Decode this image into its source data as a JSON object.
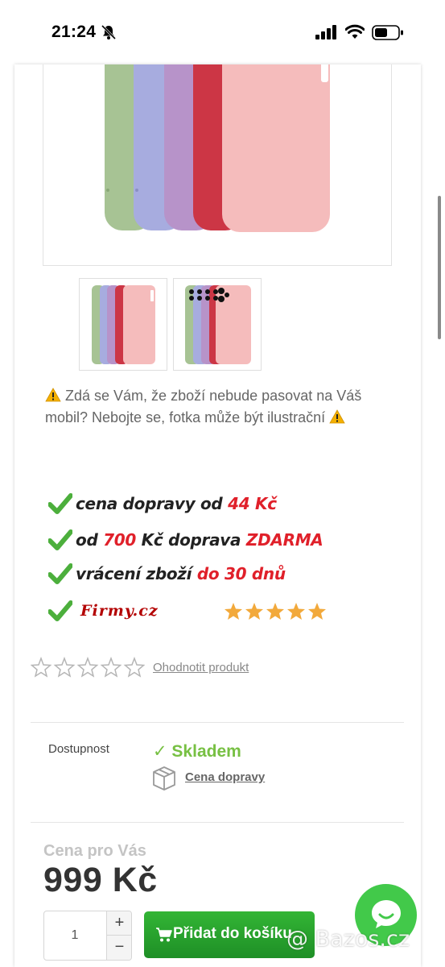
{
  "status_bar": {
    "time": "21:24"
  },
  "product_gallery": {
    "case_colors": [
      "#a7c394",
      "#a7acdf",
      "#b793c9",
      "#cc3645",
      "#f5bcbc"
    ]
  },
  "notice": {
    "text": "Zdá se Vám, že zboží nebude pasovat na Váš mobil? Nebojte se, fotka může být ilustrační"
  },
  "perks": {
    "shipping_price_prefix": "cena dopravy od ",
    "shipping_price_value": "44 Kč",
    "free_from_prefix": "od ",
    "free_from_value": "700",
    "free_from_middle": " Kč doprava ",
    "free_from_suffix": "ZDARMA",
    "returns_prefix": "vrácení zboží ",
    "returns_value": "do 30 dnů",
    "firmy_logo": "Firmy.cz"
  },
  "rating": {
    "link_text": "Ohodnotit produkt"
  },
  "availability": {
    "label": "Dostupnost",
    "status": "✓ Skladem",
    "shipping_link": "Cena dopravy"
  },
  "price": {
    "label": "Cena pro Vás",
    "value": "999 Kč"
  },
  "quantity": {
    "value": "1",
    "plus": "+",
    "minus": "−"
  },
  "cart_button": {
    "label": "Přidat do košíku"
  },
  "watermark": "@ Bazos.cz",
  "colors": {
    "accent_green": "#2aa532",
    "instock_green": "#77c043",
    "perk_red": "#e0202a"
  }
}
